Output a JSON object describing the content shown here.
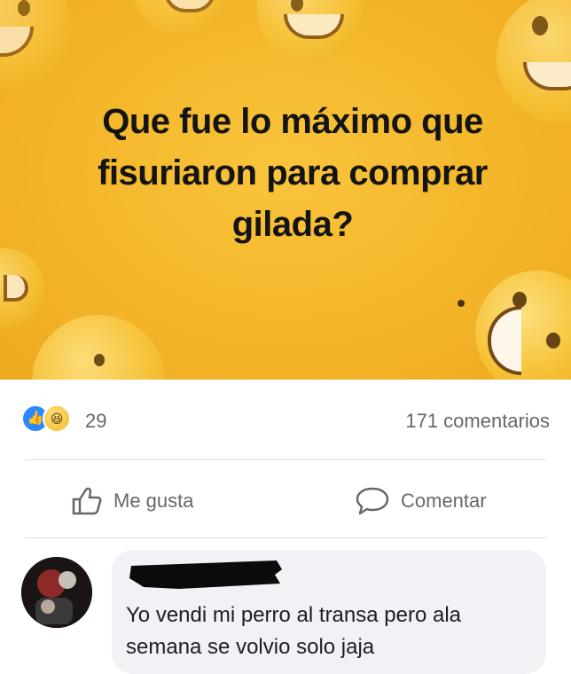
{
  "post": {
    "question": "Que fue lo máximo que fisuriaron para comprar gilada?",
    "background_color": "#f4b62a"
  },
  "stats": {
    "reaction_icons": [
      "like-icon",
      "haha-icon"
    ],
    "reaction_count": "29",
    "comment_count": "171 comentarios"
  },
  "actions": {
    "like_label": "Me gusta",
    "like_icon": "thumbs-up-icon",
    "comment_label": "Comentar",
    "comment_icon": "speech-bubble-icon"
  },
  "comment": {
    "author_redacted": true,
    "text": "Yo vendi mi perro al transa pero ala semana se volvio solo jaja"
  },
  "colors": {
    "like_blue": "#2d88ff",
    "secondary_text": "#65676b",
    "comment_bubble": "#f0f2f5"
  }
}
